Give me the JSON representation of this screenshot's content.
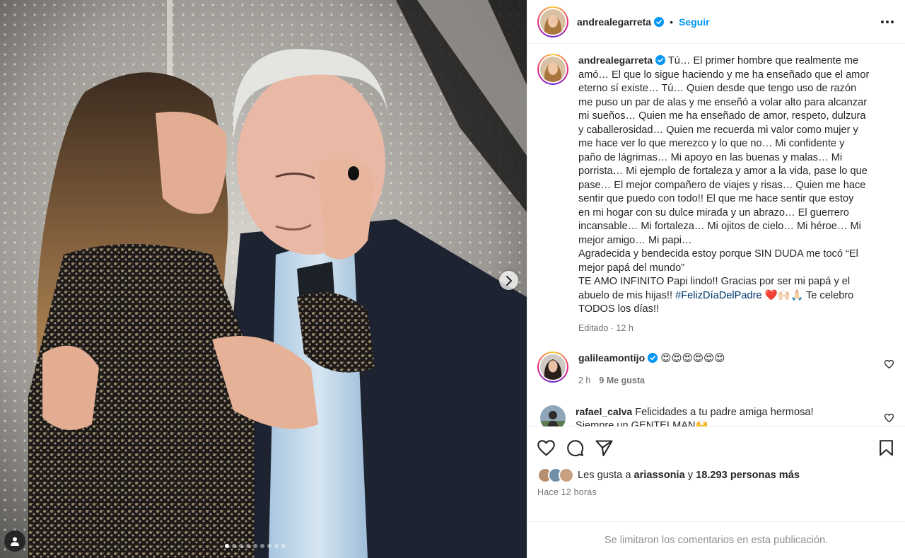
{
  "post": {
    "username": "andrealegarreta",
    "follow_label": "Seguir",
    "separator": "•",
    "caption_lines": [
      "Tú… El primer hombre que realmente me",
      "amó… El que lo sigue haciendo y me ha enseñado que el amor",
      "eterno sí existe… Tú… Quien desde que tengo uso de razón",
      "me puso un par de alas y me enseñó a volar alto para alcanzar",
      "mi sueños… Quien me ha enseñado de amor, respeto, dulzura",
      "y caballerosidad… Quien me recuerda mi valor como mujer y",
      "me hace ver lo que merezco y lo que no… Mi confidente y",
      "paño de lágrimas… Mi apoyo en las buenas y malas… Mi",
      "porrista… Mi ejemplo de fortaleza y amor a la vida, pase lo que",
      "pase… El mejor compañero de viajes y risas… Quien me hace",
      "sentir que puedo con todo!! El que me hace sentir que estoy",
      "en mi hogar con su dulce mirada y un abrazo… El guerrero",
      "incansable… Mi fortaleza… Mi ojitos de cielo… Mi héroe… Mi",
      "mejor amigo… Mi papi…",
      "Agradecida y bendecida estoy porque SIN DUDA me tocó “El",
      "mejor papá del mundo”",
      "TE AMO INFINITO Papi lindo!! Gracias por ser mi papá y el"
    ],
    "caption_pre_hashtag": "abuelo de mis hijas!! ",
    "hashtag": "#FelizDíaDelPadre",
    "caption_emoji": " ❤️🙌🏻🙏🏻",
    "caption_post_hashtag": " Te celebro",
    "caption_last": "TODOS los días!!",
    "edited_label": "Editado",
    "edited_time": "12 h"
  },
  "comments": [
    {
      "username": "galileamontijo",
      "text": "😍😍😍😍😍😍",
      "time": "2 h",
      "likes": "9 Me gusta"
    },
    {
      "username": "rafael_calva",
      "text": "Felicidades a tu padre amiga hermosa!",
      "text2": "Siempre un GENTELMAN🙌"
    }
  ],
  "likes": {
    "prefix": "Les gusta a ",
    "first_user": "ariassonia",
    "middle": " y ",
    "count_text": "18.293 personas más"
  },
  "time_ago": "Hace 12 horas",
  "comments_limited": "Se limitaron los comentarios en esta publicación.",
  "carousel": {
    "total": 9,
    "active_index": 0
  },
  "icons": {
    "next": "chevron-right-icon",
    "tag": "user-tag-icon",
    "like": "heart-icon",
    "comment": "comment-bubble-icon",
    "share": "paper-plane-icon",
    "save": "bookmark-icon",
    "more": "more-options-icon",
    "verified": "verified-badge-icon"
  },
  "colors": {
    "accent": "#0095f6",
    "verified": "#0095f6",
    "hashtag": "#00376b",
    "muted": "#737373"
  }
}
